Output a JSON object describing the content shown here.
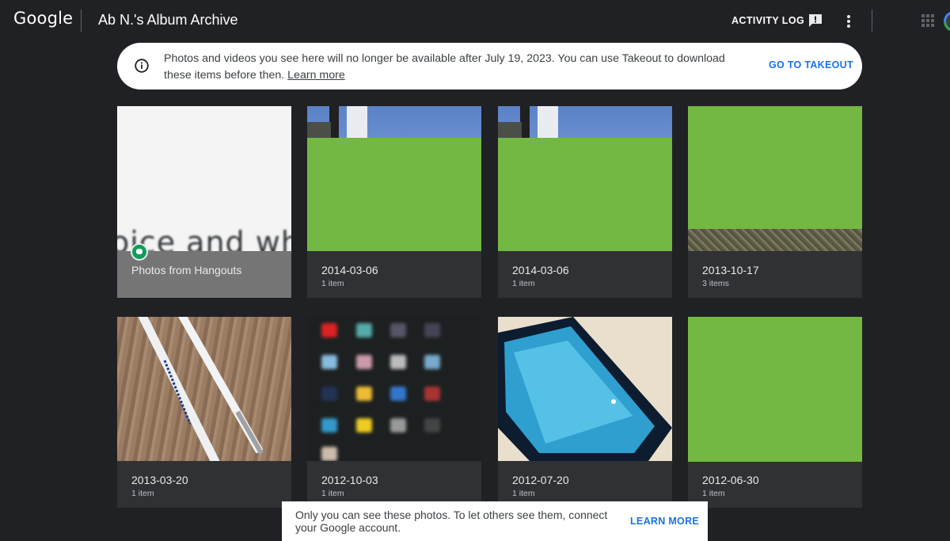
{
  "header": {
    "logo": "Google",
    "title": "Ab N.'s Album Archive",
    "activity_log": "ACTIVITY LOG",
    "icons": [
      "feedback-icon",
      "more-vert-icon",
      "apps-grid-icon",
      "account-avatar"
    ]
  },
  "banner": {
    "icon": "info-icon",
    "text": "Photos and videos you see here will no longer be available after July 19, 2023. You can use Takeout to download these items before then.",
    "link": "Learn more",
    "action": "GO TO TAKEOUT"
  },
  "albums": [
    {
      "title": "Photos from Hangouts",
      "count": "",
      "preview_text": "oice and wh"
    },
    {
      "title": "2014-03-06",
      "count": "1 item"
    },
    {
      "title": "2014-03-06",
      "count": "1 item"
    },
    {
      "title": "2013-10-17",
      "count": "3 items"
    },
    {
      "title": "2013-03-20",
      "count": "1 item"
    },
    {
      "title": "2012-10-03",
      "count": "1 item"
    },
    {
      "title": "2012-07-20",
      "count": "1 item"
    },
    {
      "title": "2012-06-30",
      "count": "1 item"
    }
  ],
  "snackbar": {
    "text": "Only you can see these photos. To let others see them, connect your Google account.",
    "action": "LEARN MORE"
  },
  "colors": {
    "background": "#202124",
    "card": "#303134",
    "accent": "#1a73e8",
    "placeholder_green": "#72b842"
  }
}
